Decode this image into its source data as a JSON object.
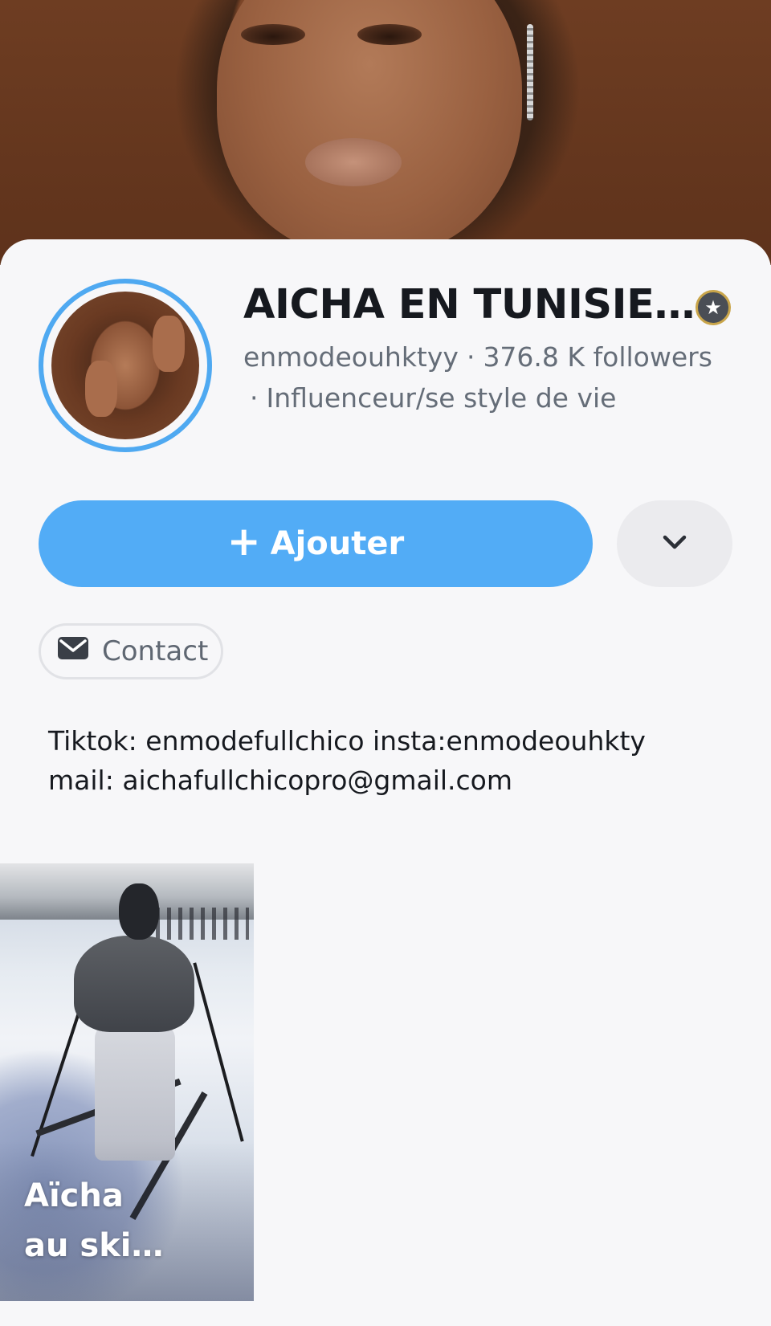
{
  "profile": {
    "display_name": "AICHA EN TUNISIE…",
    "username": "enmodeouhktyy",
    "followers": "376.8 K followers",
    "separator": "·",
    "category": "Influenceur/se style de vie",
    "badge_icon": "star-badge-icon"
  },
  "actions": {
    "add_plus": "+",
    "add_label": "Ajouter",
    "more_icon": "chevron-down-icon",
    "contact_label": "Contact",
    "contact_icon": "envelope-icon"
  },
  "bio": {
    "line1": "Tiktok: enmodefullchico insta:enmodeouhkty",
    "line2": "mail: aichafullchicopro@gmail.com"
  },
  "stories": [
    {
      "title": "Aïcha\nau ski…"
    }
  ],
  "colors": {
    "accent": "#52acf6",
    "ring": "#4fa9f1",
    "background": "#f7f7f9",
    "text_primary": "#16191f",
    "text_secondary": "#656d78"
  }
}
